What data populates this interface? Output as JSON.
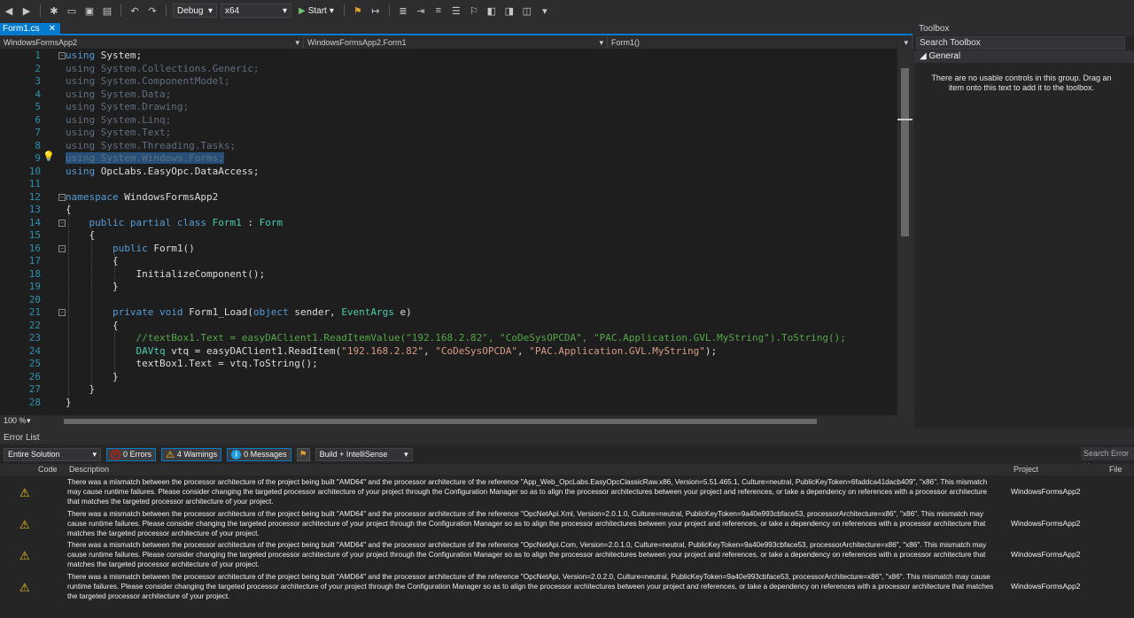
{
  "toolbar": {
    "config": "Debug",
    "platform": "x64",
    "start_label": "Start"
  },
  "tabs": {
    "active": "Form1.cs",
    "close_glyph": "✕"
  },
  "navbar": {
    "project": "WindowsFormsApp2",
    "class": "WindowsFormsApp2.Form1",
    "member": "Form1()"
  },
  "code_lines": [
    {
      "n": "1",
      "html": "<span class=\"kw\">using</span> System;"
    },
    {
      "n": "2",
      "html": "<span class=\"dim\">using</span> <span class=\"dim\">System.Collections.Generic;</span>"
    },
    {
      "n": "3",
      "html": "<span class=\"dim\">using</span> <span class=\"dim\">System.ComponentModel;</span>"
    },
    {
      "n": "4",
      "html": "<span class=\"dim\">using</span> <span class=\"dim\">System.Data;</span>"
    },
    {
      "n": "5",
      "html": "<span class=\"dim\">using</span> <span class=\"dim\">System.Drawing;</span>"
    },
    {
      "n": "6",
      "html": "<span class=\"dim\">using</span> <span class=\"dim\">System.Linq;</span>"
    },
    {
      "n": "7",
      "html": "<span class=\"dim\">using</span> <span class=\"dim\">System.Text;</span>"
    },
    {
      "n": "8",
      "html": "<span class=\"dim\">using</span> <span class=\"dim\">System.Threading.Tasks;</span>"
    },
    {
      "n": "9",
      "html": "<span class=\"sel\"><span class=\"dim\">using</span> <span class=\"dim\">System.Windows.Forms;</span></span>"
    },
    {
      "n": "10",
      "html": "<span class=\"kw\">using</span> OpcLabs.EasyOpc.DataAccess;"
    },
    {
      "n": "11",
      "html": ""
    },
    {
      "n": "12",
      "html": "<span class=\"kw\">namespace</span> WindowsFormsApp2"
    },
    {
      "n": "13",
      "html": "{"
    },
    {
      "n": "14",
      "html": "    <span class=\"kw\">public</span> <span class=\"kw\">partial</span> <span class=\"kw\">class</span> <span class=\"ty\">Form1</span> : <span class=\"ty\">Form</span>"
    },
    {
      "n": "15",
      "html": "    {"
    },
    {
      "n": "16",
      "html": "        <span class=\"kw\">public</span> Form1()"
    },
    {
      "n": "17",
      "html": "        {"
    },
    {
      "n": "18",
      "html": "            InitializeComponent();"
    },
    {
      "n": "19",
      "html": "        }"
    },
    {
      "n": "20",
      "html": ""
    },
    {
      "n": "21",
      "html": "        <span class=\"kw\">private</span> <span class=\"kw\">void</span> Form1_Load(<span class=\"kw\">object</span> sender, <span class=\"ty\">EventArgs</span> e)"
    },
    {
      "n": "22",
      "html": "        {"
    },
    {
      "n": "23",
      "html": "            <span class=\"cm\">//textBox1.Text = easyDAClient1.ReadItemValue(\"192.168.2.82\", \"CoDeSysOPCDA\", \"PAC.Application.GVL.MyString\").ToString();</span>"
    },
    {
      "n": "24",
      "html": "            <span class=\"ty\">DAVtq</span> vtq = easyDAClient1.ReadItem(<span class=\"str\">\"192.168.2.82\"</span>, <span class=\"str\">\"CoDeSysOPCDA\"</span>, <span class=\"str\">\"PAC.Application.GVL.MyString\"</span>);"
    },
    {
      "n": "25",
      "html": "            textBox1.Text = vtq.ToString();"
    },
    {
      "n": "26",
      "html": "        }"
    },
    {
      "n": "27",
      "html": "    }"
    },
    {
      "n": "28",
      "html": "}"
    }
  ],
  "folds": [
    "1",
    "12",
    "14",
    "16",
    "21"
  ],
  "zoom": "100 %",
  "toolbox": {
    "title": "Toolbox",
    "search_placeholder": "Search Toolbox",
    "group": "General",
    "empty_text": "There are no usable controls in this group. Drag an item onto this text to add it to the toolbox."
  },
  "error_list": {
    "title": "Error List",
    "scope": "Entire Solution",
    "errors_label": "0 Errors",
    "warnings_label": "4 Warnings",
    "messages_label": "0 Messages",
    "build_filter": "Build + IntelliSense",
    "search_placeholder": "Search Error List",
    "columns": {
      "code": "Code",
      "description": "Description",
      "project": "Project",
      "file": "File"
    },
    "rows": [
      {
        "description": "There was a mismatch between the processor architecture of the project being built \"AMD64\" and the processor architecture of the reference \"App_Web_OpcLabs.EasyOpcClassicRaw.x86, Version=5.51.465.1, Culture=neutral, PublicKeyToken=6faddca41dacb409\", \"x86\". This mismatch may cause runtime failures. Please consider changing the targeted processor architecture of your project through the Configuration Manager so as to align the processor architectures between your project and references, or take a dependency on references with a processor architecture that matches the targeted processor architecture of your project.",
        "project": "WindowsFormsApp2"
      },
      {
        "description": "There was a mismatch between the processor architecture of the project being built \"AMD64\" and the processor architecture of the reference \"OpcNetApi.Xml, Version=2.0.1.0, Culture=neutral, PublicKeyToken=9a40e993cbface53, processorArchitecture=x86\", \"x86\". This mismatch may cause runtime failures. Please consider changing the targeted processor architecture of your project through the Configuration Manager so as to align the processor architectures between your project and references, or take a dependency on references with a processor architecture that matches the targeted processor architecture of your project.",
        "project": "WindowsFormsApp2"
      },
      {
        "description": "There was a mismatch between the processor architecture of the project being built \"AMD64\" and the processor architecture of the reference \"OpcNetApi.Com, Version=2.0.1.0, Culture=neutral, PublicKeyToken=9a40e993cbface53, processorArchitecture=x86\", \"x86\". This mismatch may cause runtime failures. Please consider changing the targeted processor architecture of your project through the Configuration Manager so as to align the processor architectures between your project and references, or take a dependency on references with a processor architecture that matches the targeted processor architecture of your project.",
        "project": "WindowsFormsApp2"
      },
      {
        "description": "There was a mismatch between the processor architecture of the project being built \"AMD64\" and the processor architecture of the reference \"OpcNetApi, Version=2.0.2.0, Culture=neutral, PublicKeyToken=9a40e993cbface53, processorArchitecture=x86\", \"x86\". This mismatch may cause runtime failures. Please consider changing the targeted processor architecture of your project through the Configuration Manager so as to align the processor architectures between your project and references, or take a dependency on references with a processor architecture that matches the targeted processor architecture of your project.",
        "project": "WindowsFormsApp2"
      }
    ]
  },
  "colors": {
    "accent": "#007acc",
    "warning": "#f5c518",
    "error": "#e51400",
    "editor_bg": "#1e1e1e"
  }
}
